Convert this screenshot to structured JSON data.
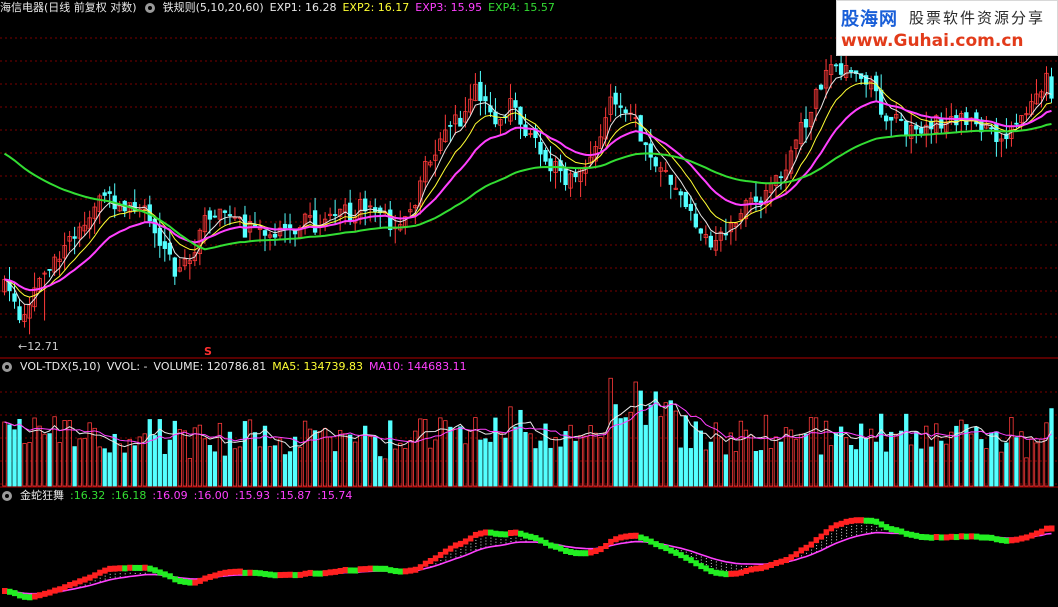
{
  "colors": {
    "up": "#ff3a3a",
    "down": "#54ffff",
    "white": "#e8e8e8",
    "magenta": "#ff40ff",
    "green": "#33dd33",
    "yellow": "#ffff33",
    "grid": "#7a0000"
  },
  "main_header": {
    "title": "海信电器(日线 前复权 对数)",
    "indicator": "铁规则(5,10,20,60)",
    "exp1": "EXP1: 16.28",
    "exp2": "EXP2: 16.17",
    "exp3": "EXP3: 15.95",
    "exp4": "EXP4: 15.57"
  },
  "low_label": "←12.71",
  "signal_mark": "S",
  "vol_header": {
    "name": "VOL-TDX(5,10)",
    "vvol": "VVOL: -",
    "volume": "VOLUME: 120786.81",
    "ma5": "MA5: 134739.83",
    "ma10": "MA10: 144683.11"
  },
  "snake_header": {
    "name": "金蛇狂舞",
    "values": [
      ":16.32",
      ":16.18",
      ":16.09",
      ":16.00",
      ":15.93",
      ":15.87",
      ":15.74"
    ]
  },
  "logo": {
    "brand": "股海网",
    "slogan": "股票软件资源分享",
    "url": "www.Guhai.com.cn"
  },
  "chart_data": [
    {
      "type": "candlestick",
      "title": "海信电器(日线 前复权 对数)",
      "ylim": [
        12.3,
        17.8
      ],
      "grid": true,
      "annotations": [
        {
          "text": "12.71",
          "kind": "low"
        },
        {
          "text": "S",
          "kind": "signal"
        }
      ],
      "series": [
        {
          "name": "EXP1",
          "last": 16.28
        },
        {
          "name": "EXP2",
          "last": 16.17
        },
        {
          "name": "EXP3",
          "last": 15.95
        },
        {
          "name": "EXP4",
          "last": 15.57
        }
      ],
      "close_path": [
        13.2,
        12.75,
        13.3,
        13.6,
        14.0,
        14.2,
        14.6,
        14.5,
        14.4,
        14.1,
        13.4,
        13.7,
        14.2,
        14.3,
        14.1,
        14.0,
        13.9,
        14.1,
        14.2,
        14.1,
        14.3,
        14.4,
        14.3,
        14.2,
        14.3,
        15.2,
        15.6,
        15.9,
        16.5,
        15.8,
        16.2,
        15.6,
        15.2,
        14.9,
        15.0,
        15.5,
        16.3,
        16.0,
        15.5,
        15.0,
        14.6,
        14.1,
        13.8,
        14.1,
        14.6,
        14.5,
        14.9,
        15.6,
        16.3,
        16.8,
        16.9,
        16.6,
        16.1,
        15.8,
        15.6,
        15.8,
        16.0,
        15.9,
        15.7,
        15.6,
        15.8,
        16.4,
        16.8
      ]
    },
    {
      "type": "bar",
      "title": "VOL-TDX(5,10)",
      "series": [
        {
          "name": "VOLUME",
          "last": 120786.81
        },
        {
          "name": "MA5",
          "last": 134739.83
        },
        {
          "name": "MA10",
          "last": 144683.11
        }
      ]
    },
    {
      "type": "line",
      "title": "金蛇狂舞",
      "values": [
        16.32,
        16.18,
        16.09,
        16.0,
        15.93,
        15.87,
        15.74
      ]
    }
  ]
}
